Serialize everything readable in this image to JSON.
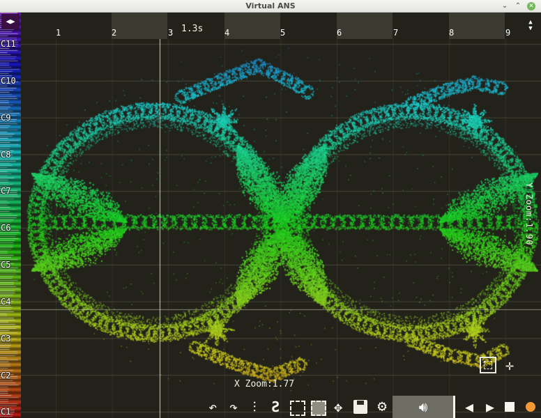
{
  "window": {
    "title": "Virtual ANS",
    "min_icon": "minimize-icon",
    "max_icon": "maximize-icon",
    "close_icon": "close-icon"
  },
  "ruler": {
    "labels": [
      "1",
      "2",
      "3",
      "4",
      "5",
      "6",
      "7",
      "8",
      "9"
    ],
    "playhead_time": "1.3s"
  },
  "keyboard": {
    "notes": [
      "C11",
      "C10",
      "C9",
      "C8",
      "C7",
      "C6",
      "C5",
      "C4",
      "C3",
      "C2",
      "C1"
    ],
    "nav_icon": "left-right-arrows-icon"
  },
  "zoom": {
    "x_label": "X Zoom:1.77",
    "y_label": "Y Zoom:1.90"
  },
  "right_nav_icon": "up-down-arrows-icon",
  "toolbar": {
    "undo_icon": "undo-icon",
    "redo_icon": "redo-icon",
    "mixer_icon": "mixer-sliders-icon",
    "brush_icon": "brush-icon",
    "select_icon": "selection-rectangle-icon",
    "select_all_icon": "select-all-icon",
    "move_icon": "move-icon",
    "save_icon": "floppy-disk-icon",
    "settings_icon": "gear-icon",
    "volume_icon": "speaker-icon",
    "play_back_icon": "play-backward-icon",
    "play_icon": "play-icon",
    "stop_icon": "stop-icon",
    "record_icon": "record-icon"
  },
  "view_tools": {
    "fit_icon": "fit-to-view-icon",
    "center_icon": "center-crosshair-icon"
  },
  "colors": {
    "canvas_bg": "#22221b",
    "ruler_band": "#3a3a30",
    "record": "#f39a38",
    "title_bar": "#efefed"
  }
}
